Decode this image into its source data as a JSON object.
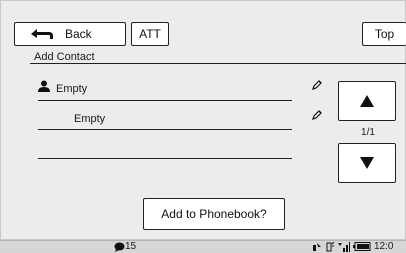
{
  "toolbar": {
    "back_label": "Back",
    "att_label": "ATT",
    "top_label": "Top"
  },
  "section": {
    "title": "Add Contact"
  },
  "rows": [
    {
      "text": "Empty",
      "icon": "person-icon"
    },
    {
      "text": "Empty"
    },
    {
      "text": ""
    }
  ],
  "pager": {
    "indicator": "1/1"
  },
  "actions": {
    "add_label": "Add to Phonebook?"
  },
  "status": {
    "message_count": "15",
    "time": "12:0"
  }
}
